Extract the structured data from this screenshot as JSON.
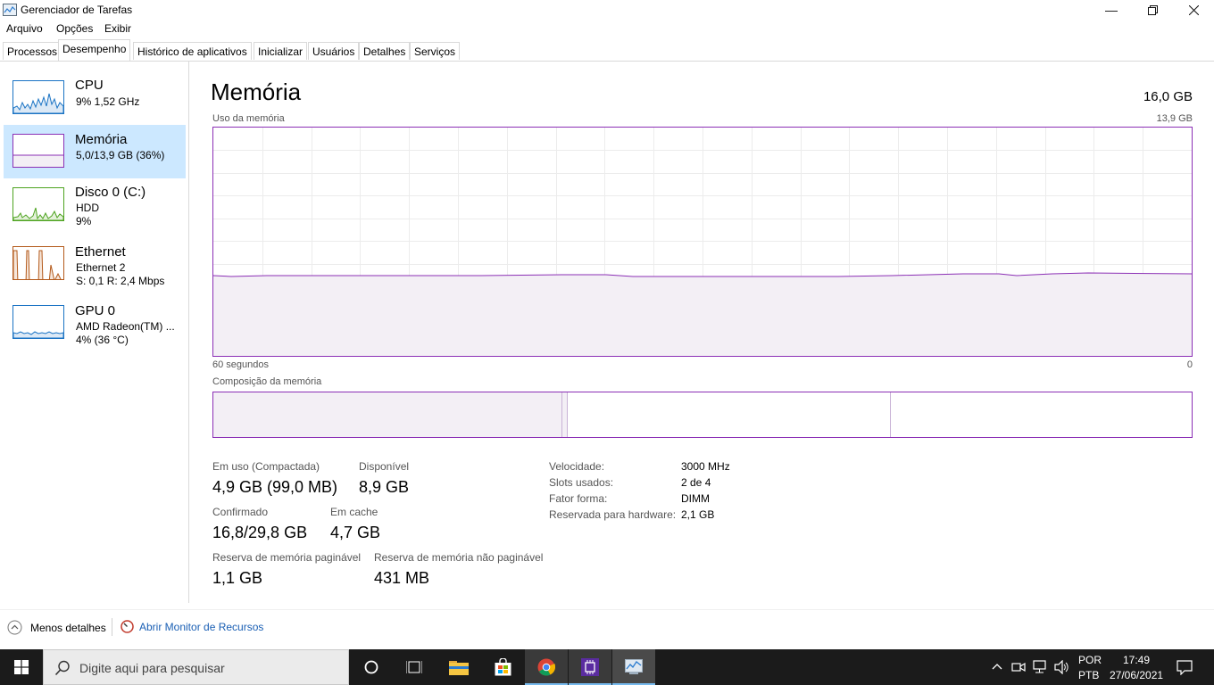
{
  "window": {
    "title": "Gerenciador de Tarefas"
  },
  "menu": [
    "Arquivo",
    "Opções",
    "Exibir"
  ],
  "tabs": [
    "Processos",
    "Desempenho",
    "Histórico de aplicativos",
    "Inicializar",
    "Usuários",
    "Detalhes",
    "Serviços"
  ],
  "active_tab": "Desempenho",
  "sidebar": [
    {
      "title": "CPU",
      "sub1": "9%  1,52 GHz",
      "sub2": "",
      "color": "#1a73c4"
    },
    {
      "title": "Memória",
      "sub1": "5,0/13,9 GB (36%)",
      "sub2": "",
      "color": "#8b2fb5"
    },
    {
      "title": "Disco 0 (C:)",
      "sub1": "HDD",
      "sub2": "9%",
      "color": "#4da31f"
    },
    {
      "title": "Ethernet",
      "sub1": "Ethernet 2",
      "sub2": "S: 0,1  R: 2,4 Mbps",
      "color": "#b3591a"
    },
    {
      "title": "GPU 0",
      "sub1": "AMD Radeon(TM) ...",
      "sub2": "4% (36 °C)",
      "color": "#1a73c4"
    }
  ],
  "main": {
    "title": "Memória",
    "total": "16,0 GB",
    "usage_label": "Uso da memória",
    "usage_max": "13,9 GB",
    "time_left": "60 segundos",
    "time_right": "0",
    "composition_label": "Composição da memória",
    "usage_fraction": 0.36
  },
  "stats": {
    "in_use_label": "Em uso (Compactada)",
    "in_use_value": "4,9 GB (99,0 MB)",
    "available_label": "Disponível",
    "available_value": "8,9 GB",
    "committed_label": "Confirmado",
    "committed_value": "16,8/29,8 GB",
    "cached_label": "Em cache",
    "cached_value": "4,7 GB",
    "paged_label": "Reserva de memória paginável",
    "paged_value": "1,1 GB",
    "nonpaged_label": "Reserva de memória não paginável",
    "nonpaged_value": "431 MB"
  },
  "specs": {
    "speed_label": "Velocidade:",
    "speed_value": "3000 MHz",
    "slots_label": "Slots usados:",
    "slots_value": "2 de 4",
    "form_label": "Fator forma:",
    "form_value": "DIMM",
    "reserved_label": "Reservada para hardware:",
    "reserved_value": "2,1 GB"
  },
  "footer": {
    "less_details": "Menos detalhes",
    "resource_monitor": "Abrir Monitor de Recursos"
  },
  "taskbar": {
    "search_placeholder": "Digite aqui para pesquisar",
    "lang1": "POR",
    "lang2": "PTB",
    "time": "17:49",
    "date": "27/06/2021"
  },
  "colors": {
    "memory": "#8b2fb5",
    "memory_fill": "#f3eff5",
    "selected": "#cce8ff",
    "link": "#1a5fb4"
  }
}
